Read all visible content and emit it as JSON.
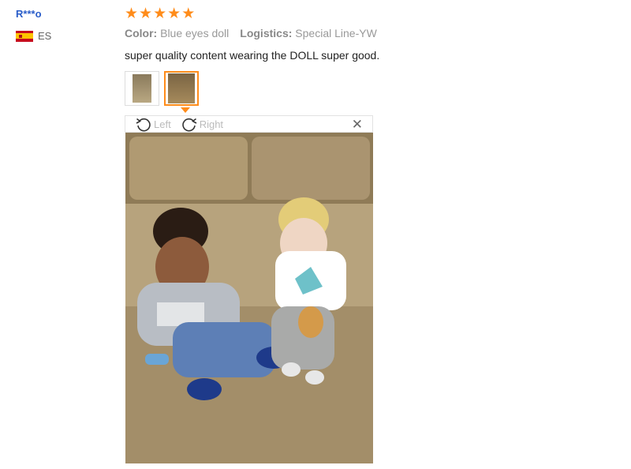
{
  "reviewer": {
    "name": "R***o",
    "country_code": "ES",
    "flag": "spain-flag-icon"
  },
  "rating": {
    "stars": 5,
    "max": 5,
    "color": "#ff8c1a"
  },
  "attributes": {
    "color_label": "Color:",
    "color_value": "Blue eyes doll",
    "logistics_label": "Logistics:",
    "logistics_value": "Special Line-YW"
  },
  "review": {
    "text": "super quality content wearing the DOLL super good."
  },
  "thumbnails": [
    {
      "active": false
    },
    {
      "active": true
    }
  ],
  "viewer": {
    "rotate_left_label": "Left",
    "rotate_right_label": "Right",
    "close_icon": "close-icon"
  },
  "colors": {
    "accent": "#ff8c1a",
    "reviewer_name": "#2a5dc9"
  }
}
